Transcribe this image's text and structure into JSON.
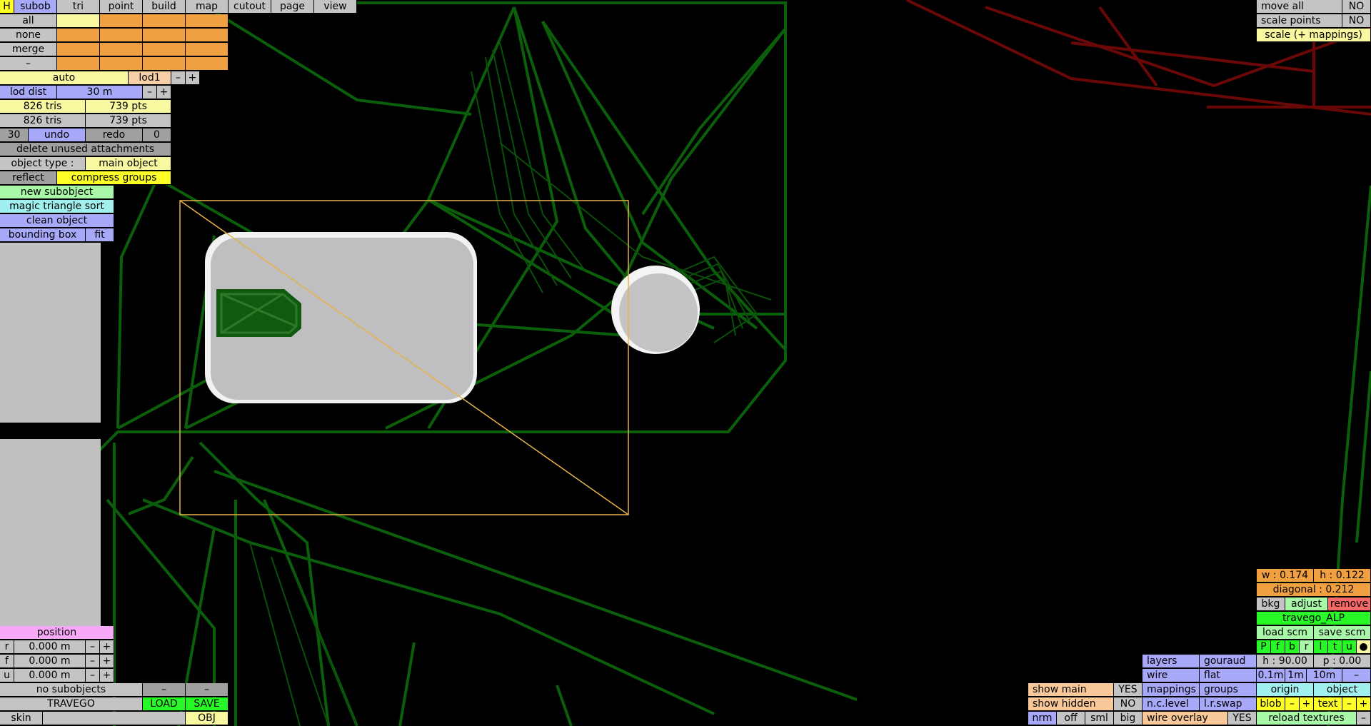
{
  "menu": {
    "h": "H",
    "tabs": [
      "subob",
      "tri",
      "point",
      "build",
      "map",
      "cutout",
      "page",
      "view"
    ]
  },
  "selection": {
    "all": "all",
    "none": "none",
    "merge": "merge",
    "dash": "–"
  },
  "lod": {
    "auto": "auto",
    "name": "lod1",
    "minus": "–",
    "plus": "+",
    "dist_label": "lod dist",
    "dist_value": "30 m"
  },
  "stats": {
    "tris1": "826 tris",
    "pts1": "739 pts",
    "tris2": "826 tris",
    "pts2": "739 pts"
  },
  "history": {
    "count": "30",
    "undo": "undo",
    "redo": "redo",
    "redo_count": "0"
  },
  "actions": {
    "delete_unused": "delete unused attachments",
    "object_type_label": "object type :",
    "object_type_value": "main object",
    "reflect": "reflect",
    "compress": "compress groups",
    "new_subobject": "new subobject",
    "magic_sort": "magic triangle sort",
    "clean": "clean object",
    "bounding_box": "bounding box",
    "fit": "fit"
  },
  "position": {
    "title": "position",
    "rows": [
      {
        "axis": "r",
        "value": "0.000 m"
      },
      {
        "axis": "f",
        "value": "0.000 m"
      },
      {
        "axis": "u",
        "value": "0.000 m"
      }
    ],
    "minus": "–",
    "plus": "+"
  },
  "file": {
    "subobjects": "no subobjects",
    "dash": "–",
    "name": "TRAVEGO",
    "load": "LOAD",
    "save": "SAVE",
    "skin": "skin",
    "obj": "OBJ"
  },
  "top_right": {
    "move_all": "move all",
    "move_all_val": "NO",
    "scale_points": "scale points",
    "scale_points_val": "NO",
    "scale_mappings": "scale (+ mappings)"
  },
  "bg_panel": {
    "w": "w : 0.174",
    "h": "h : 0.122",
    "diagonal": "diagonal : 0.212",
    "bkg": "bkg",
    "adjust": "adjust",
    "remove": "remove",
    "texture": "travego_ALP",
    "load_scm": "load scm",
    "save_scm": "save scm",
    "views": [
      "P",
      "f",
      "b",
      "r",
      "l",
      "t",
      "u",
      "●"
    ],
    "heading": "h : 90.00",
    "pitch": "p : 0.00",
    "steps": [
      "0.1m",
      "1m",
      "10m",
      "–"
    ],
    "origin": "origin",
    "object": "object",
    "blob": "blob",
    "text": "text",
    "minus": "–",
    "plus": "+",
    "reload": "reload textures",
    "reload_minus": "–"
  },
  "render": {
    "layers": "layers",
    "gouraud": "gouraud",
    "wire": "wire",
    "flat": "flat",
    "mappings": "mappings",
    "groups": "groups",
    "nclevel": "n.c.level",
    "lrswap": "l.r.swap"
  },
  "show": {
    "main": "show main",
    "main_val": "YES",
    "hidden": "show hidden",
    "hidden_val": "NO",
    "wire_overlay": "wire overlay",
    "wire_overlay_val": "YES",
    "sizes": [
      "nrm",
      "off",
      "sml",
      "big"
    ]
  },
  "colors": {
    "wire": "#0a5a0a",
    "wire_bright": "#1a8a1a",
    "red_wire": "#6a0808",
    "select": "#e8b048",
    "panel": "#c0c0c0"
  }
}
